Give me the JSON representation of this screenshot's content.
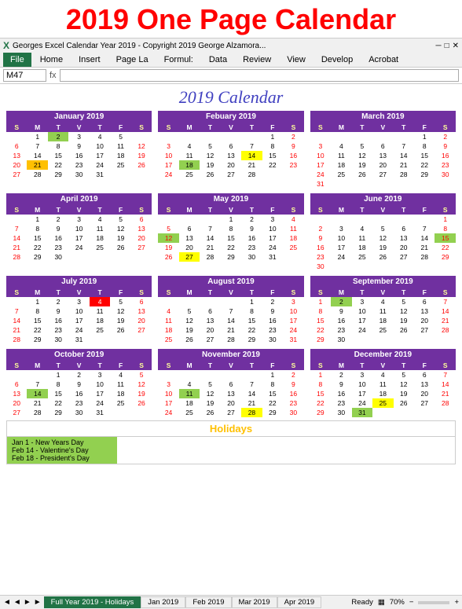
{
  "mainTitle": "2019 One Page Calendar",
  "windowTitle": "Georges Excel Calendar Year 2019 - Copyright 2019 George Alzamora...",
  "cellRef": "M47",
  "calendarHeading": "2019 Calendar",
  "ribbonTabs": [
    "File",
    "Home",
    "Insert",
    "Page La",
    "Formul:",
    "Data",
    "Review",
    "View",
    "Develop",
    "Acrobat"
  ],
  "activeTab": "File",
  "months": [
    {
      "name": "January 2019",
      "days": [
        {
          "row": [
            null,
            1,
            2,
            3,
            4,
            5
          ],
          "special": {
            "2": "green"
          }
        },
        {
          "row": [
            6,
            7,
            8,
            9,
            10,
            11,
            12
          ],
          "special": {}
        },
        {
          "row": [
            13,
            14,
            15,
            16,
            17,
            18,
            19
          ],
          "special": {}
        },
        {
          "row": [
            20,
            21,
            22,
            23,
            24,
            25,
            26
          ],
          "special": {
            "21": "orange"
          }
        },
        {
          "row": [
            27,
            28,
            29,
            30,
            31,
            null,
            null
          ],
          "special": {}
        }
      ]
    },
    {
      "name": "Febuary 2019",
      "days": [
        {
          "row": [
            null,
            null,
            null,
            null,
            null,
            1,
            2
          ],
          "special": {}
        },
        {
          "row": [
            3,
            4,
            5,
            6,
            7,
            8,
            9
          ],
          "special": {}
        },
        {
          "row": [
            10,
            11,
            12,
            13,
            14,
            15,
            16
          ],
          "special": {
            "14": "yellow"
          }
        },
        {
          "row": [
            17,
            18,
            19,
            20,
            21,
            22,
            23
          ],
          "special": {
            "18": "lime"
          }
        },
        {
          "row": [
            24,
            25,
            26,
            27,
            28,
            null,
            null
          ],
          "special": {}
        }
      ]
    },
    {
      "name": "March 2019",
      "days": [
        {
          "row": [
            null,
            null,
            null,
            null,
            null,
            1,
            2
          ],
          "special": {}
        },
        {
          "row": [
            3,
            4,
            5,
            6,
            7,
            8,
            9
          ],
          "special": {}
        },
        {
          "row": [
            10,
            11,
            12,
            13,
            14,
            15,
            16
          ],
          "special": {}
        },
        {
          "row": [
            17,
            18,
            19,
            20,
            21,
            22,
            23
          ],
          "special": {}
        },
        {
          "row": [
            24,
            25,
            26,
            27,
            28,
            29,
            30
          ],
          "special": {}
        },
        {
          "row": [
            31,
            null,
            null,
            null,
            null,
            null,
            null
          ],
          "special": {}
        }
      ]
    },
    {
      "name": "April 2019",
      "days": [
        {
          "row": [
            null,
            1,
            2,
            3,
            4,
            5,
            6
          ],
          "special": {}
        },
        {
          "row": [
            7,
            8,
            9,
            10,
            11,
            12,
            13
          ],
          "special": {}
        },
        {
          "row": [
            14,
            15,
            16,
            17,
            18,
            19,
            20
          ],
          "special": {}
        },
        {
          "row": [
            21,
            22,
            23,
            24,
            25,
            26,
            27
          ],
          "special": {}
        },
        {
          "row": [
            28,
            29,
            30,
            null,
            null,
            null,
            null
          ],
          "special": {}
        }
      ]
    },
    {
      "name": "May 2019",
      "days": [
        {
          "row": [
            null,
            null,
            null,
            1,
            2,
            3,
            4
          ],
          "special": {}
        },
        {
          "row": [
            5,
            6,
            7,
            8,
            9,
            10,
            11
          ],
          "special": {}
        },
        {
          "row": [
            12,
            13,
            14,
            15,
            16,
            17,
            18
          ],
          "special": {
            "12": "lime"
          }
        },
        {
          "row": [
            19,
            20,
            21,
            22,
            23,
            24,
            25
          ],
          "special": {}
        },
        {
          "row": [
            26,
            27,
            28,
            29,
            30,
            31,
            null
          ],
          "special": {
            "27": "yellow"
          }
        }
      ]
    },
    {
      "name": "June 2019",
      "days": [
        {
          "row": [
            null,
            null,
            null,
            null,
            null,
            null,
            1
          ],
          "special": {}
        },
        {
          "row": [
            2,
            3,
            4,
            5,
            6,
            7,
            8
          ],
          "special": {}
        },
        {
          "row": [
            9,
            10,
            11,
            12,
            13,
            14,
            15
          ],
          "special": {
            "15": "lime"
          }
        },
        {
          "row": [
            16,
            17,
            18,
            19,
            20,
            21,
            22
          ],
          "special": {}
        },
        {
          "row": [
            23,
            24,
            25,
            26,
            27,
            28,
            29
          ],
          "special": {}
        },
        {
          "row": [
            30,
            null,
            null,
            null,
            null,
            null,
            null
          ],
          "special": {}
        }
      ]
    },
    {
      "name": "July 2019",
      "days": [
        {
          "row": [
            null,
            1,
            2,
            3,
            4,
            5,
            6
          ],
          "special": {
            "4": "red"
          }
        },
        {
          "row": [
            7,
            8,
            9,
            10,
            11,
            12,
            13
          ],
          "special": {}
        },
        {
          "row": [
            14,
            15,
            16,
            17,
            18,
            19,
            20
          ],
          "special": {}
        },
        {
          "row": [
            21,
            22,
            23,
            24,
            25,
            26,
            27
          ],
          "special": {}
        },
        {
          "row": [
            28,
            29,
            30,
            31,
            null,
            null,
            null
          ],
          "special": {}
        }
      ]
    },
    {
      "name": "August 2019",
      "days": [
        {
          "row": [
            null,
            null,
            null,
            null,
            1,
            2,
            3
          ],
          "special": {}
        },
        {
          "row": [
            4,
            5,
            6,
            7,
            8,
            9,
            10
          ],
          "special": {}
        },
        {
          "row": [
            11,
            12,
            13,
            14,
            15,
            16,
            17
          ],
          "special": {}
        },
        {
          "row": [
            18,
            19,
            20,
            21,
            22,
            23,
            24
          ],
          "special": {}
        },
        {
          "row": [
            25,
            26,
            27,
            28,
            29,
            30,
            31
          ],
          "special": {}
        }
      ]
    },
    {
      "name": "September 2019",
      "days": [
        {
          "row": [
            1,
            2,
            3,
            4,
            5,
            6,
            7
          ],
          "special": {
            "2": "lime"
          }
        },
        {
          "row": [
            8,
            9,
            10,
            11,
            12,
            13,
            14
          ],
          "special": {}
        },
        {
          "row": [
            15,
            16,
            17,
            18,
            19,
            20,
            21
          ],
          "special": {}
        },
        {
          "row": [
            22,
            23,
            24,
            25,
            26,
            27,
            28
          ],
          "special": {}
        },
        {
          "row": [
            29,
            30,
            null,
            null,
            null,
            null,
            null
          ],
          "special": {}
        }
      ]
    },
    {
      "name": "October 2019",
      "days": [
        {
          "row": [
            null,
            null,
            1,
            2,
            3,
            4,
            5
          ],
          "special": {}
        },
        {
          "row": [
            6,
            7,
            8,
            9,
            10,
            11,
            12
          ],
          "special": {}
        },
        {
          "row": [
            13,
            14,
            15,
            16,
            17,
            18,
            19
          ],
          "special": {
            "14": "lime"
          }
        },
        {
          "row": [
            20,
            21,
            22,
            23,
            24,
            25,
            26
          ],
          "special": {}
        },
        {
          "row": [
            27,
            28,
            29,
            30,
            31,
            null,
            null
          ],
          "special": {}
        }
      ]
    },
    {
      "name": "November 2019",
      "days": [
        {
          "row": [
            null,
            null,
            null,
            null,
            null,
            1,
            2
          ],
          "special": {}
        },
        {
          "row": [
            3,
            4,
            5,
            6,
            7,
            8,
            9
          ],
          "special": {}
        },
        {
          "row": [
            10,
            11,
            12,
            13,
            14,
            15,
            16
          ],
          "special": {
            "11": "lime"
          }
        },
        {
          "row": [
            17,
            18,
            19,
            20,
            21,
            22,
            23
          ],
          "special": {}
        },
        {
          "row": [
            24,
            25,
            26,
            27,
            28,
            29,
            30
          ],
          "special": {
            "28": "yellow"
          }
        }
      ]
    },
    {
      "name": "December 2019",
      "days": [
        {
          "row": [
            1,
            2,
            3,
            4,
            5,
            6,
            7
          ],
          "special": {}
        },
        {
          "row": [
            8,
            9,
            10,
            11,
            12,
            13,
            14
          ],
          "special": {}
        },
        {
          "row": [
            15,
            16,
            17,
            18,
            19,
            20,
            21
          ],
          "special": {}
        },
        {
          "row": [
            22,
            23,
            24,
            25,
            26,
            27,
            28
          ],
          "special": {
            "25": "yellow"
          }
        },
        {
          "row": [
            29,
            30,
            31,
            null,
            null,
            null,
            null
          ],
          "special": {
            "31": "lime"
          }
        }
      ]
    }
  ],
  "holidaysHeader": "Holidays",
  "holidays": [
    "Jan 1 - New Years Day",
    "Feb 14 - Valentine's Day",
    "Feb 18 - President's Day"
  ],
  "sheetTabs": [
    "Full Year 2019 - Holidays",
    "Jan 2019",
    "Feb 2019",
    "Mar 2019",
    "Apr 2019"
  ],
  "activeSheet": "Full Year 2019 - Holidays",
  "statusLeft": "Ready",
  "zoomLevel": "70%",
  "weekDays": [
    "S",
    "M",
    "T",
    "V",
    "T",
    "F",
    "S"
  ]
}
